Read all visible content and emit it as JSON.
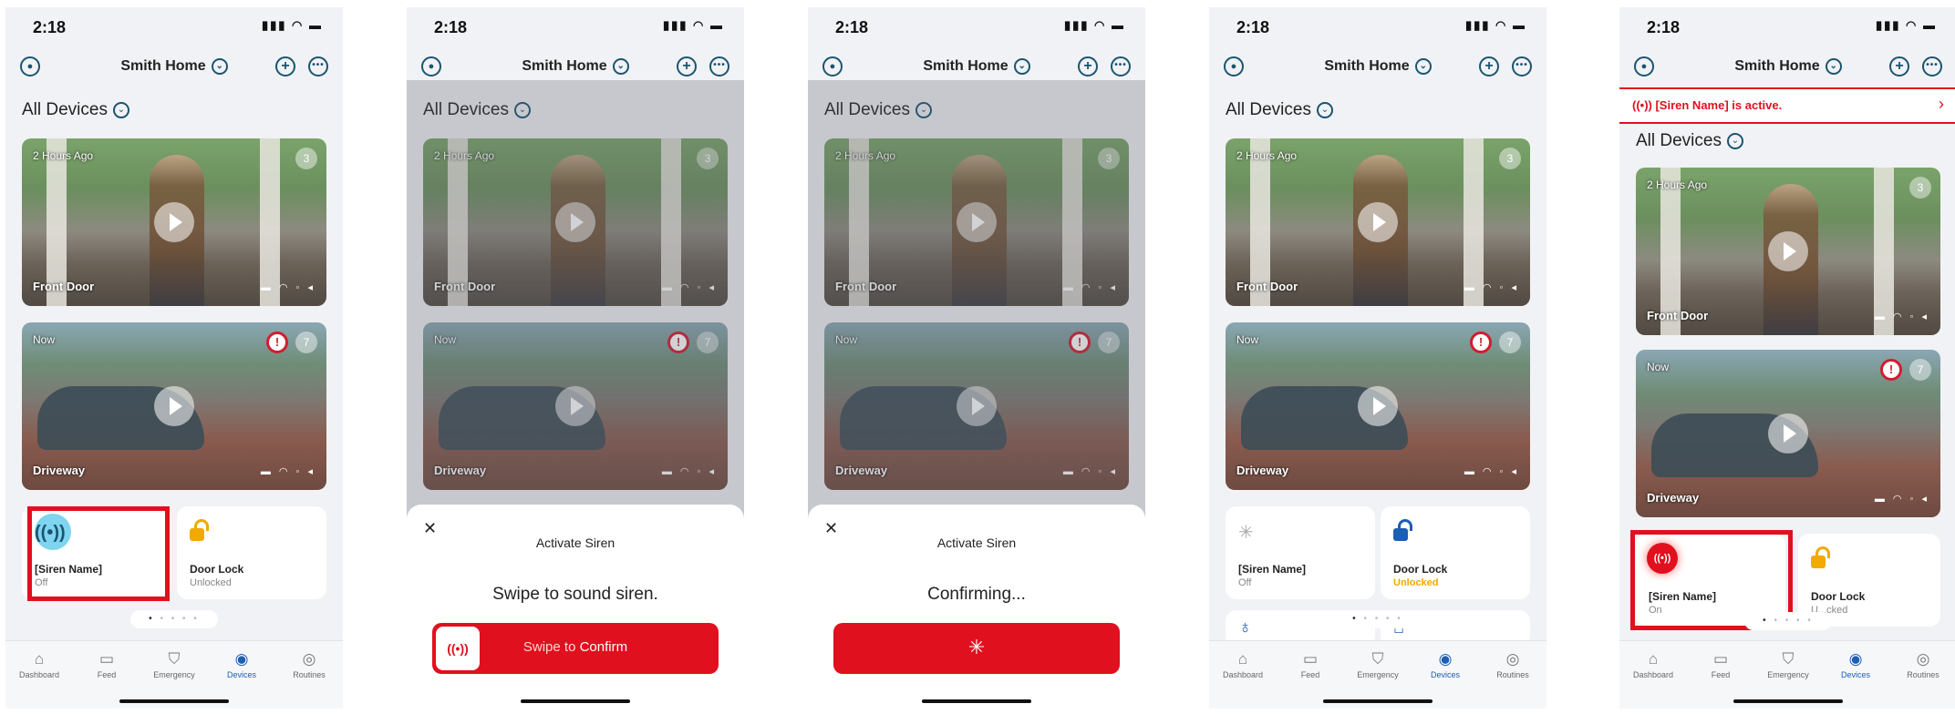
{
  "status": {
    "time": "2:18",
    "signal": "▮▮▮ ◠ ▬"
  },
  "header": {
    "home_name": "Smith Home",
    "chevron": "⌄",
    "plus": "+",
    "more": "•••",
    "account": "●"
  },
  "section_title": "All Devices",
  "cameras": {
    "front": {
      "ago": "2 Hours Ago",
      "count": "3",
      "name": "Front Door",
      "icons": "▬ ◠ ◦ ◂"
    },
    "drive": {
      "ago": "Now",
      "count": "7",
      "alert": "!",
      "name": "Driveway",
      "icons": "▬ ◠ ◦ ◂"
    }
  },
  "siren_tile": {
    "name": "[Siren Name]",
    "state_off": "Off",
    "state_on": "On",
    "icon": "((•))"
  },
  "lock_tile": {
    "name": "Door Lock",
    "state": "Unlocked",
    "state_partial": "U...cked"
  },
  "sheet": {
    "close": "✕",
    "title": "Activate Siren",
    "prompt_swipe": "Swipe to sound siren.",
    "prompt_confirming": "Confirming...",
    "swipe_label_a": "Swipe to ",
    "swipe_label_b": "Confirm",
    "spinner": "✳"
  },
  "banner": {
    "text": "((•)) [Siren Name] is active.",
    "arrow": "›"
  },
  "pager": {
    "dots": "• • • •",
    "active": "•"
  },
  "tabs": {
    "dashboard": {
      "label": "Dashboard",
      "icon": "⌂"
    },
    "feed": {
      "label": "Feed",
      "icon": "▭"
    },
    "emergency": {
      "label": "Emergency",
      "icon": "⛉"
    },
    "devices": {
      "label": "Devices",
      "icon": "◉"
    },
    "routines": {
      "label": "Routines",
      "icon": "◎"
    }
  },
  "colors": {
    "accent": "#1a5fb4",
    "siren_red": "#e0101e",
    "lock_amber": "#f2a900"
  }
}
